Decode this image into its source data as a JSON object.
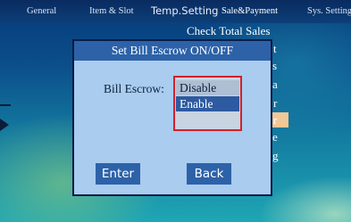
{
  "tabs": [
    {
      "label": "General"
    },
    {
      "label": "Item & Slot"
    },
    {
      "label": "Temp.Setting"
    },
    {
      "label": "Sale&Payment"
    },
    {
      "label": "Sys. Setting"
    }
  ],
  "menu_items": [
    {
      "label": "Check Total Sales"
    },
    {
      "label": "t"
    },
    {
      "label": "s"
    },
    {
      "label": "a"
    },
    {
      "label": "r"
    },
    {
      "label": "r"
    },
    {
      "label": "e"
    },
    {
      "label": "g"
    }
  ],
  "dialog": {
    "title": "Set Bill Escrow ON/OFF",
    "field_label": "Bill Escrow:",
    "options": [
      "Disable",
      "Enable"
    ],
    "selected": "Enable",
    "enter_label": "Enter",
    "back_label": "Back"
  },
  "colors": {
    "dialog_bg": "#a9ccef",
    "title_bar": "#2d62a8",
    "selection": "#2d5aa0",
    "dropdown_border": "#d4202a",
    "menu_highlight": "#f3c897"
  },
  "icons": [
    "arrow-right-icon"
  ]
}
